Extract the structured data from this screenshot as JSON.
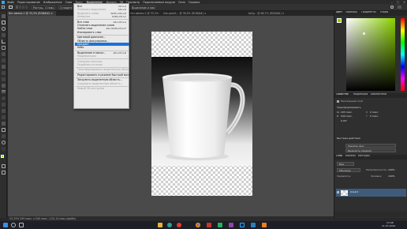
{
  "menubar": {
    "items": [
      "Файл",
      "Редактирование",
      "Изображение",
      "Слои",
      "Текст",
      "Выделение",
      "Фильтр",
      "3D",
      "Просмотр",
      "Подключаемые модули",
      "Окно",
      "Справка"
    ],
    "active_index": 5,
    "window_controls": [
      "–",
      "□",
      "✕"
    ]
  },
  "optbar": {
    "pill1": "Растуш.: 0 пикс.",
    "pill2": "Сгладить",
    "pill3": "Выделение и маска..."
  },
  "tabs": [
    {
      "label": "Без имени-1 @ 33,3% (RGB/8#) ×"
    },
    {
      "label": "Без имени-2 @ 33,3% ... ×"
    },
    {
      "label": "kak-posvit... @ 38,9% (RGB/8#) ×"
    },
    {
      "label": "beliy... @ 66,7% (RGB/8#) ×"
    }
  ],
  "menu": {
    "items": [
      {
        "label": "Все",
        "shortcut": "Ctrl+A",
        "type": "item"
      },
      {
        "label": "Отменить выделение",
        "shortcut": "Ctrl+D",
        "type": "dis"
      },
      {
        "label": "Выделить снова",
        "shortcut": "Shift+Ctrl+D",
        "type": "dis"
      },
      {
        "label": "Инверсия",
        "shortcut": "Shift+Ctrl+I",
        "type": "dis"
      },
      {
        "type": "sep"
      },
      {
        "label": "Все слои",
        "shortcut": "Alt+Ctrl+A",
        "type": "item"
      },
      {
        "label": "Отменить выделение слоев",
        "shortcut": "",
        "type": "item"
      },
      {
        "label": "Найти слои",
        "shortcut": "Alt+Shift+Ctrl+F",
        "type": "item"
      },
      {
        "label": "Изолировать слои",
        "shortcut": "",
        "type": "item"
      },
      {
        "type": "sep"
      },
      {
        "label": "Цветовой диапазон...",
        "shortcut": "",
        "type": "item"
      },
      {
        "label": "Область фокусировки...",
        "shortcut": "",
        "type": "item"
      },
      {
        "label": "Предмет",
        "shortcut": "",
        "type": "hl"
      },
      {
        "label": "Небо",
        "shortcut": "",
        "type": "item"
      },
      {
        "type": "sep"
      },
      {
        "label": "Выделение и маска...",
        "shortcut": "Alt+Ctrl+R",
        "type": "item"
      },
      {
        "label": "Модификация",
        "shortcut": "",
        "type": "dis",
        "sub": true
      },
      {
        "type": "sep"
      },
      {
        "label": "Смежные пикселы",
        "shortcut": "",
        "type": "dis"
      },
      {
        "label": "Подобные оттенки",
        "shortcut": "",
        "type": "dis"
      },
      {
        "type": "sep"
      },
      {
        "label": "Трансформировать выделенную область",
        "shortcut": "",
        "type": "dis"
      },
      {
        "type": "sep"
      },
      {
        "label": "Редактировать в режиме быстрой маски",
        "shortcut": "",
        "type": "item"
      },
      {
        "type": "sep"
      },
      {
        "label": "Загрузить выделенную область...",
        "shortcut": "",
        "type": "item"
      },
      {
        "label": "Сохранить выделенную область...",
        "shortcut": "",
        "type": "dis"
      },
      {
        "type": "sep"
      },
      {
        "label": "Новый 3D-экструзия",
        "shortcut": "",
        "type": "dis"
      }
    ]
  },
  "statusbar": {
    "text": "33,33%   295 пикс. x 540 пикс. (120,14 пикс./дюйм)"
  },
  "color_panel": {
    "tabs": [
      "Цвет",
      "Образцы",
      "Градиенты",
      "Узоры"
    ],
    "fg_color": "#8ad100"
  },
  "properties_panel": {
    "tabs": [
      "Свойства",
      "Коррекция",
      "Библиотеки"
    ],
    "section_label": "Пиксельный слой",
    "sub_label": "Трансформировать",
    "w_label": "Ш",
    "w_value": "295 пикс.",
    "h_label": "В",
    "h_value": "540 пикс.",
    "x_label": "X",
    "x_value": "0 пикс.",
    "y_label": "Y",
    "y_value": "0 пикс.",
    "angle": "0,00°",
    "quick_actions": "Быстрые действия",
    "btn_remove_bg": "Удалить фон",
    "btn_select_subject": "Выделить предмет"
  },
  "layers_panel": {
    "tabs": [
      "Слои",
      "Каналы",
      "Контуры"
    ],
    "kind_label": "Вид",
    "blend_mode": "Обычные",
    "opacity_label": "Непрозрачность:",
    "opacity_value": "100%",
    "lock_label": "Закрепить:",
    "fill_label": "Заливка:",
    "fill_value": "100%",
    "layer_name": "Слой 1"
  },
  "taskbar": {
    "time": "13:08",
    "date": "11.07.2024"
  }
}
